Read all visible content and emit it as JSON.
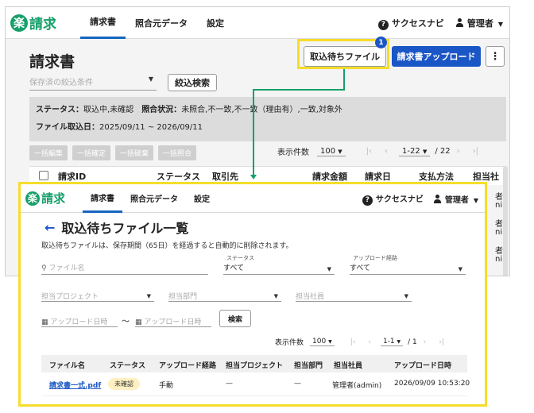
{
  "app": {
    "logo_mark": "楽",
    "logo_text": "楽請求"
  },
  "nav": {
    "items": [
      "請求書",
      "照合元データ",
      "設定"
    ],
    "help": "サクセスナビ",
    "user": "管理者"
  },
  "page": {
    "title": "請求書",
    "import_button": "取込待ちファイル",
    "import_badge": "1",
    "upload_button": "請求書アップロード",
    "more_button": "⋮",
    "saved_filter_placeholder": "保存済の絞込条件",
    "filter_button": "絞込検索",
    "conditions": {
      "status_label": "ステータス：",
      "status_value": "取込中,未確認",
      "match_label": "照合状況：",
      "match_value": "未照合,不一致,不一致（理由有）,一致,対象外",
      "date_label": "ファイル取込日：",
      "date_value": "2025/09/11 ~ 2026/09/11"
    },
    "bulk_actions": [
      "一括編集",
      "一括確定",
      "一括破棄",
      "一括照合"
    ],
    "pager": {
      "label": "表示件数",
      "per_page": "100",
      "range": "1-22",
      "total": "/ 22"
    },
    "table_headers": [
      "請求ID",
      "ステータス",
      "取引先",
      "請求金額",
      "請求日",
      "支払方法",
      "担当社"
    ],
    "peek_cells": [
      "者",
      "ni",
      "者",
      "ni",
      "者",
      "ni",
      "者",
      "ni"
    ]
  },
  "modal": {
    "nav": [
      "請求書",
      "照合元データ",
      "設定"
    ],
    "help": "サクセスナビ",
    "user": "管理者",
    "title": "取込待ちファイル一覧",
    "description": "取込待ちファイルは、保存期間（65日）を経過すると自動的に削除されます。",
    "file_search_placeholder": "ファイル名",
    "status_label": "ステータス",
    "status_value": "すべて",
    "route_label": "アップロード経路",
    "route_value": "すべて",
    "project_placeholder": "担当プロジェクト",
    "dept_placeholder": "担当部門",
    "staff_placeholder": "担当社員",
    "date_from_placeholder": "アップロード日時",
    "date_tilde": "～",
    "date_to_placeholder": "アップロード日時",
    "search_button": "検索",
    "pager": {
      "label": "表示件数",
      "per_page": "100",
      "range": "1-1",
      "total": "/ 1"
    },
    "table_headers": [
      "ファイル名",
      "ステータス",
      "アップロード経路",
      "担当プロジェクト",
      "担当部門",
      "担当社員",
      "アップロード日時"
    ],
    "rows": [
      {
        "file": "請求書一式.pdf",
        "status": "未確認",
        "route": "手動",
        "project": "—",
        "dept": "—",
        "staff": "管理者(admin)",
        "date": "2026/09/09 10:53:20"
      }
    ]
  },
  "colors": {
    "brand": "#16a06a",
    "primary": "#1a56c5",
    "highlight": "#f5dd2a"
  }
}
